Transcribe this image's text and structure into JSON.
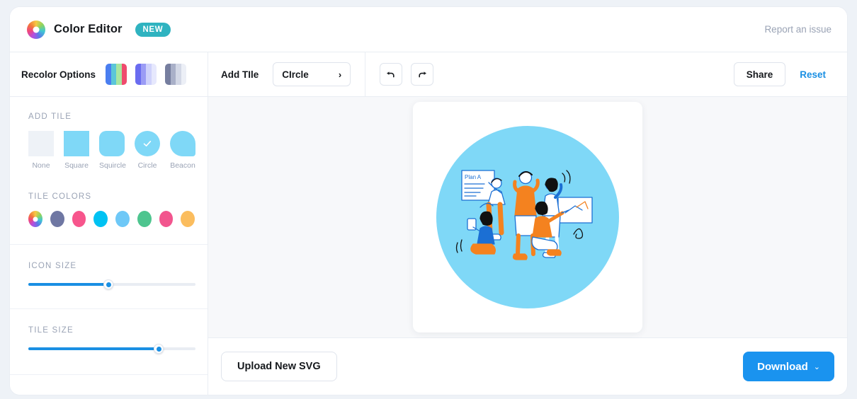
{
  "header": {
    "logo_icon": "color-wheel-icon",
    "title": "Color Editor",
    "badge": "NEW",
    "report_link": "Report an issue"
  },
  "toolbar": {
    "recolor_label": "Recolor Options",
    "palettes": [
      {
        "name": "palette-vivid",
        "colors": [
          "#4a7ef0",
          "#5bc6d8",
          "#a9e6a0",
          "#ef4a6d"
        ]
      },
      {
        "name": "palette-indigo",
        "colors": [
          "#6a6cf0",
          "#9b9cf5",
          "#cfd2fb",
          "#e6e8fd"
        ]
      },
      {
        "name": "palette-slate",
        "colors": [
          "#767e9f",
          "#a9b0c8",
          "#d3d8e6",
          "#eceff6"
        ]
      }
    ],
    "add_tile_label": "Add TIle",
    "add_tile_value": "CIrcle",
    "chevron": "›",
    "undo_icon": "undo-arrow-icon",
    "redo_icon": "redo-arrow-icon",
    "share_label": "Share",
    "reset_label": "Reset"
  },
  "sidebar": {
    "search_icon": "magnifier-icon",
    "add_tile": {
      "title": "ADD TILE",
      "options": [
        {
          "name": "none",
          "label": "None",
          "shape": "none",
          "selected": false
        },
        {
          "name": "square",
          "label": "Square",
          "shape": "square",
          "selected": false
        },
        {
          "name": "squircle",
          "label": "Squircle",
          "shape": "squircle",
          "selected": false
        },
        {
          "name": "circle",
          "label": "Circle",
          "shape": "circle",
          "selected": true
        },
        {
          "name": "beacon",
          "label": "Beacon",
          "shape": "beacon",
          "selected": false
        }
      ],
      "tile_color": "#7fd8f7",
      "none_color": "#eef2f7"
    },
    "tile_colors": {
      "title": "TILE COLORS",
      "swatches": [
        {
          "name": "rainbow",
          "color": "rainbow"
        },
        {
          "name": "slate",
          "color": "#6f77a3"
        },
        {
          "name": "pink",
          "color": "#f7558c"
        },
        {
          "name": "cyan",
          "color": "#00c2f3"
        },
        {
          "name": "light-blue",
          "color": "#6ec8f7"
        },
        {
          "name": "green",
          "color": "#4ec58f"
        },
        {
          "name": "magenta",
          "color": "#f2558e"
        },
        {
          "name": "orange",
          "color": "#fbbd5e"
        }
      ]
    },
    "icon_size": {
      "title": "ICON SIZE",
      "value": 48
    },
    "tile_size": {
      "title": "TILE SIZE",
      "value": 78
    }
  },
  "canvas": {
    "background": "#f7f8fa",
    "tile_shape": "circle",
    "tile_color": "#7fd8f7",
    "artwork_name": "team-presentation-illustration",
    "artwork_board_text": "Plan A"
  },
  "footer": {
    "upload_label": "Upload New SVG",
    "download_label": "Download",
    "download_chevron": "⌄"
  },
  "colors": {
    "accent_blue": "#1a93ef",
    "link_blue": "#1a8fe3",
    "badge_teal": "#2fb3c0",
    "muted": "#9aa3b5",
    "illustration_orange": "#f4821f",
    "illustration_blue": "#1b6fd4"
  }
}
